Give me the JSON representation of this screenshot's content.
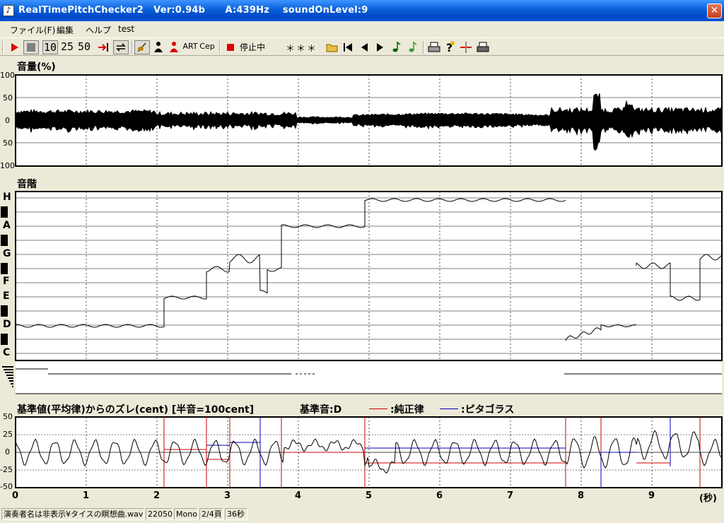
{
  "window": {
    "title": "RealTimePitchChecker2   Ver:0.94b      A:439Hz    soundOnLevel:9",
    "close_glyph": "✕"
  },
  "menu": [
    "ファイル(F)",
    "編集",
    "ヘルプ",
    "test"
  ],
  "toolbar": {
    "speed_options": [
      "10",
      "25",
      "50"
    ],
    "art_label": "ART",
    "cep_label": "Cep",
    "status": "停止中",
    "readout": "＊＊＊",
    "icons": [
      "play-icon",
      "stop-icon",
      "skip-end-icon",
      "loop-icon",
      "violin-icon",
      "player-icon",
      "player-red-icon",
      "folder-open-icon",
      "first-icon",
      "prev-icon",
      "next-icon",
      "note-icon",
      "note-green-icon",
      "print-icon",
      "help-icon",
      "marker-icon",
      "printer-icon"
    ]
  },
  "volume_panel": {
    "title": "音量(%)",
    "y_labels": [
      "100",
      "50",
      "0",
      "50",
      "100"
    ]
  },
  "pitch_panel": {
    "title": "音階",
    "notes": [
      "H",
      "A",
      "G",
      "F",
      "E",
      "D",
      "C"
    ]
  },
  "deviation_panel": {
    "title": "基準値(平均律)からのズレ(cent) [半音=100cent]",
    "reference": "基準音:D",
    "legend": [
      {
        "label": ":純正律",
        "color": "#d00000"
      },
      {
        "label": ":ピタゴラス",
        "color": "#0000c0"
      }
    ],
    "y_labels": [
      "50",
      "25",
      "0",
      "-25",
      "-50"
    ]
  },
  "time_axis": {
    "ticks": [
      "0",
      "1",
      "2",
      "3",
      "4",
      "5",
      "6",
      "7",
      "8",
      "9"
    ],
    "unit": "(秒)"
  },
  "status_bar": {
    "file": "演奏者名は非表示¥タイスの瞑想曲.wav",
    "rate": "22050",
    "channels": "Mono",
    "page": "2/4頁",
    "duration": "36秒"
  }
}
